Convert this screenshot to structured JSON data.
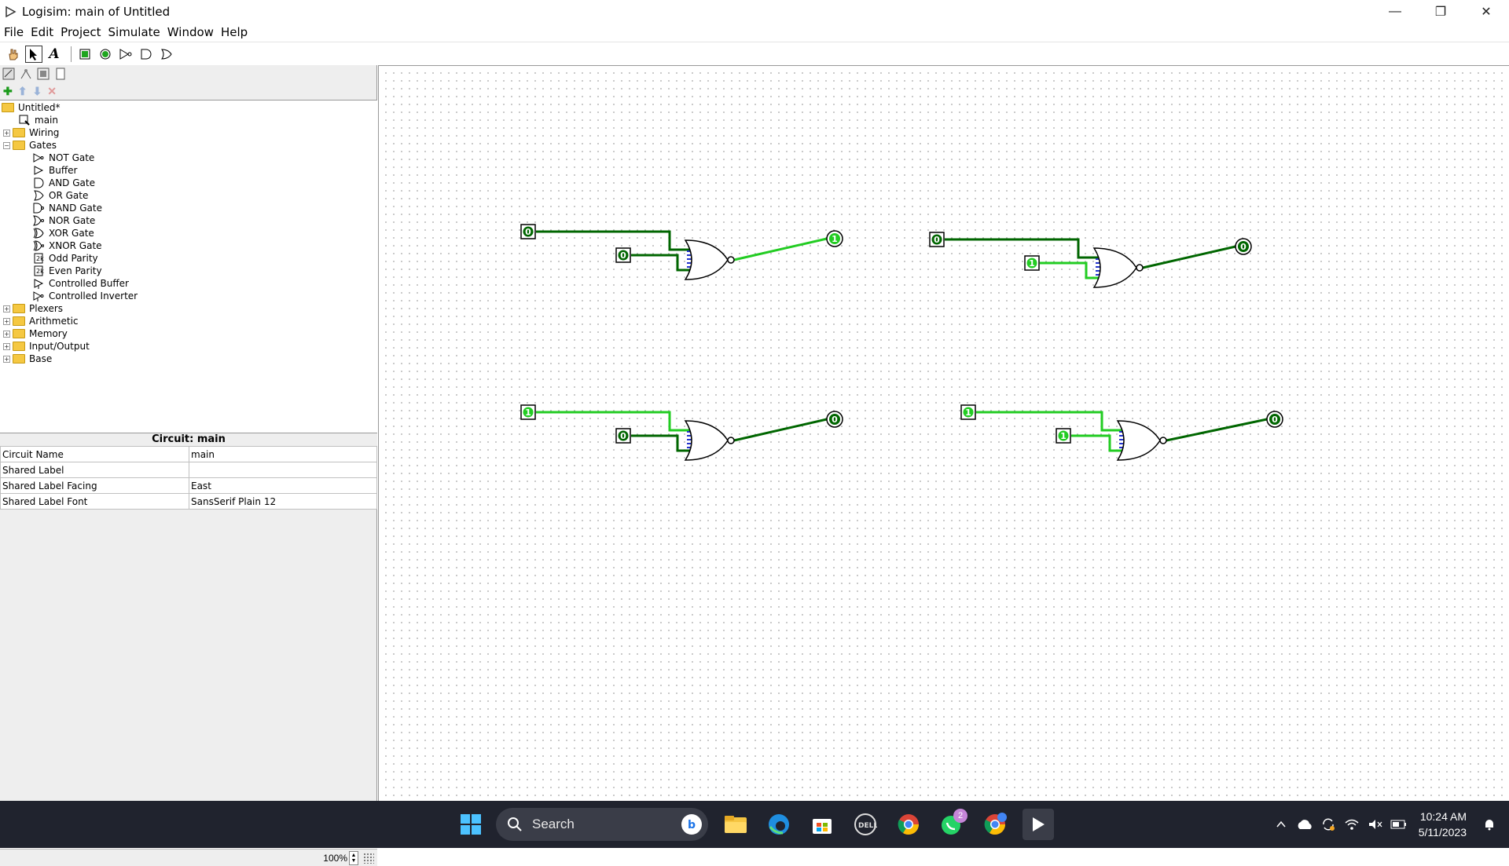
{
  "window": {
    "title": "Logisim: main of Untitled",
    "minimize": "—",
    "maximize": "❐",
    "close": "✕"
  },
  "menu": [
    "File",
    "Edit",
    "Project",
    "Simulate",
    "Window",
    "Help"
  ],
  "toolbar": {
    "text_tool": "A",
    "selected_tool": "select"
  },
  "treetools": {
    "add": "✚",
    "up": "⬆",
    "down": "⬇",
    "remove": "✕"
  },
  "tree": {
    "project": "Untitled*",
    "circuit": "main",
    "folders": [
      "Wiring",
      "Gates",
      "Plexers",
      "Arithmetic",
      "Memory",
      "Input/Output",
      "Base"
    ],
    "gates": [
      "NOT Gate",
      "Buffer",
      "AND Gate",
      "OR Gate",
      "NAND Gate",
      "NOR Gate",
      "XOR Gate",
      "XNOR Gate",
      "Odd Parity",
      "Even Parity",
      "Controlled Buffer",
      "Controlled Inverter"
    ]
  },
  "props": {
    "header": "Circuit: main",
    "rows": [
      {
        "key": "Circuit Name",
        "value": "main"
      },
      {
        "key": "Shared Label",
        "value": ""
      },
      {
        "key": "Shared Label Facing",
        "value": "East"
      },
      {
        "key": "Shared Label Font",
        "value": "SansSerif Plain 12"
      }
    ]
  },
  "zoom": "100%",
  "circuits": [
    {
      "in_a": "0",
      "in_b": "0",
      "out": "1"
    },
    {
      "in_a": "0",
      "in_b": "1",
      "out": "0"
    },
    {
      "in_a": "1",
      "in_b": "0",
      "out": "0"
    },
    {
      "in_a": "1",
      "in_b": "1",
      "out": "0"
    }
  ],
  "colors": {
    "wire_on": "#22cc22",
    "wire_off": "#006600",
    "pin_on": "#22cc22",
    "pin_off": "#006600"
  },
  "taskbar": {
    "search_label": "Search",
    "whatsapp_badge": "2",
    "time": "10:24 AM",
    "date": "5/11/2023"
  }
}
